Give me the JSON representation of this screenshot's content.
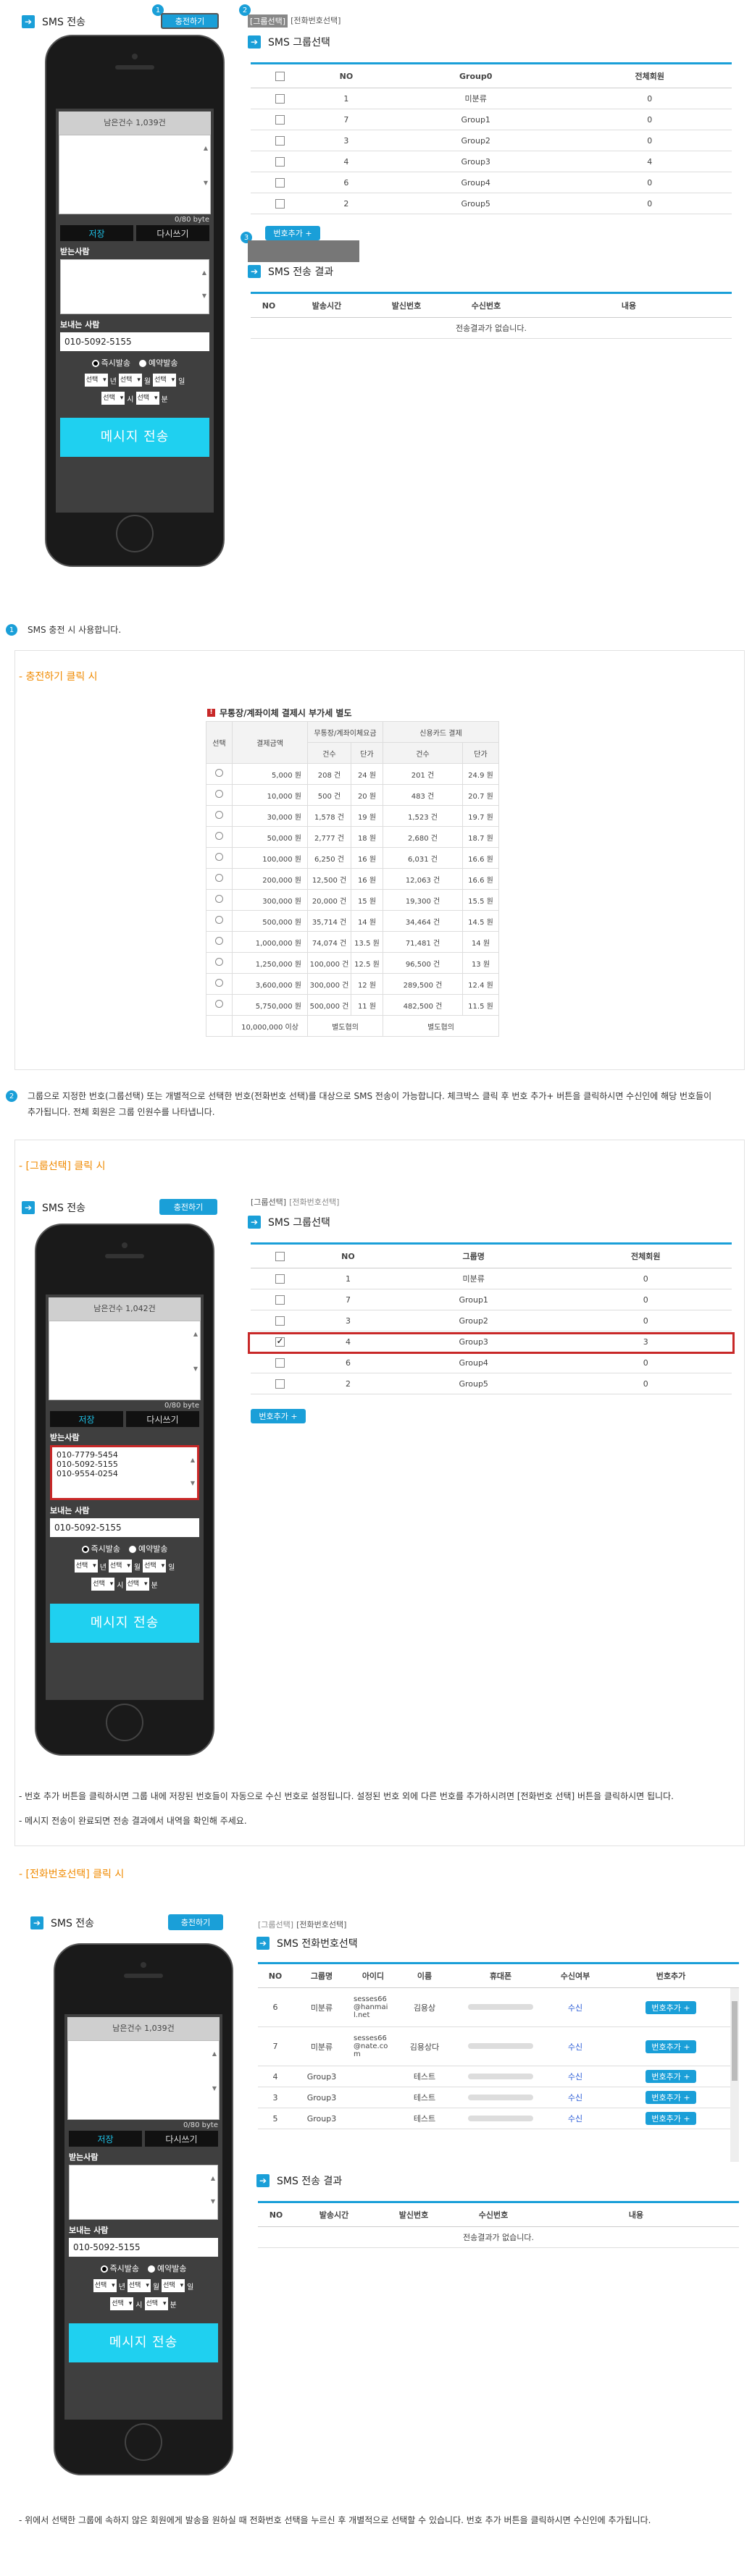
{
  "colors": {
    "accent": "#1a9fd8",
    "orange": "#f08a00",
    "red": "#c82828"
  },
  "top": {
    "sms_title": "SMS 전송",
    "charge_btn": "충전하기",
    "tab_group": "[그룹선택]",
    "tab_phone": "[전화번호선택]",
    "group_title": "SMS 그룹선택",
    "group_headers": [
      "",
      "NO",
      "Group0",
      "전체회원"
    ],
    "group_rows": [
      [
        "1",
        "미분류",
        "0"
      ],
      [
        "7",
        "Group1",
        "0"
      ],
      [
        "3",
        "Group2",
        "0"
      ],
      [
        "4",
        "Group3",
        "4"
      ],
      [
        "6",
        "Group4",
        "0"
      ],
      [
        "2",
        "Group5",
        "0"
      ]
    ],
    "add_btn": "번호추가 +",
    "result_title": "SMS 전송 결과",
    "result_headers": [
      "NO",
      "발송시간",
      "발신번호",
      "수신번호",
      "내용"
    ],
    "result_empty": "전송결과가 없습니다."
  },
  "phone": {
    "remain1": "남은건수 1,039건",
    "remain2": "남은건수 1,042건",
    "remain3": "남은건수 1,039건",
    "byte": "0/80 byte",
    "save": "저장",
    "rewrite": "다시쓰기",
    "recv_label": "받는사람",
    "send_label": "보내는 사람",
    "sender": "010-5092-5155",
    "radio_now": "즉시발송",
    "radio_reserve": "예약발송",
    "sel": "선택",
    "year": "년",
    "month": "월",
    "day": "일",
    "hour": "시",
    "minute": "분",
    "send_btn": "메시지 전송",
    "recv_numbers": [
      "010-7779-5454",
      "010-5092-5155",
      "010-9554-0254"
    ]
  },
  "badges": [
    "1",
    "2",
    "3"
  ],
  "note1": "SMS 충전 시 사용합니다.",
  "charge": {
    "heading": "- 충전하기 클릭 시",
    "table_title": "무통장/계좌이체 결제시 부가세 별도",
    "h_select": "선택",
    "h_amount": "결제금액",
    "h_bank": "무통장/계좌이체요금",
    "h_card": "신용카드 결제",
    "h_count": "건수",
    "h_unit": "단가",
    "rows": [
      [
        "5,000 원",
        "208 건",
        "24 원",
        "201 건",
        "24.9 원"
      ],
      [
        "10,000 원",
        "500 건",
        "20 원",
        "483 건",
        "20.7 원"
      ],
      [
        "30,000 원",
        "1,578 건",
        "19 원",
        "1,523 건",
        "19.7 원"
      ],
      [
        "50,000 원",
        "2,777 건",
        "18 원",
        "2,680 건",
        "18.7 원"
      ],
      [
        "100,000 원",
        "6,250 건",
        "16 원",
        "6,031 건",
        "16.6 원"
      ],
      [
        "200,000 원",
        "12,500 건",
        "16 원",
        "12,063 건",
        "16.6 원"
      ],
      [
        "300,000 원",
        "20,000 건",
        "15 원",
        "19,300 건",
        "15.5 원"
      ],
      [
        "500,000 원",
        "35,714 건",
        "14 원",
        "34,464 건",
        "14.5 원"
      ],
      [
        "1,000,000 원",
        "74,074 건",
        "13.5 원",
        "71,481 건",
        "14 원"
      ],
      [
        "1,250,000 원",
        "100,000 건",
        "12.5 원",
        "96,500 건",
        "13 원"
      ],
      [
        "3,600,000 원",
        "300,000 건",
        "12 원",
        "289,500 건",
        "12.4 원"
      ],
      [
        "5,750,000 원",
        "500,000 건",
        "11 원",
        "482,500 건",
        "11.5 원"
      ]
    ],
    "last_row": [
      "10,000,000 이상",
      "별도협의",
      "별도협의"
    ]
  },
  "note2_l1": "그룹으로 지정한 번호(그룹선택) 또는 개별적으로 선택한 번호(전화번호 선택)를 대상으로 SMS 전송이 가능합니다. 체크박스 클릭 후 번호 추가+ 버튼을 클릭하시면 수신인에 해당 번호들이",
  "note2_l2": "추가됩니다. 전체 회원은 그룹 인원수를 나타냅니다.",
  "group": {
    "heading": "- [그룹선택] 클릭 시",
    "headers": [
      "",
      "NO",
      "그룹명",
      "전체회원"
    ],
    "rows": [
      [
        "1",
        "미분류",
        "0"
      ],
      [
        "7",
        "Group1",
        "0"
      ],
      [
        "3",
        "Group2",
        "0"
      ],
      [
        "4",
        "Group3",
        "3"
      ],
      [
        "6",
        "Group4",
        "0"
      ],
      [
        "2",
        "Group5",
        "0"
      ]
    ],
    "checked_index": 3,
    "note1": "- 번호 추가 버튼을 클릭하시면 그룹 내에 저장된 번호들이 자동으로 수신 번호로 설정됩니다. 설정된 번호 외에 다른 번호를 추가하시려면 [전화번호 선택] 버튼을 클릭하시면 됩니다.",
    "note2": "- 메시지 전송이 완료되면 전송 결과에서 내역을 확인해 주세요."
  },
  "phonesel": {
    "heading": "- [전화번호선택] 클릭 시",
    "title": "SMS 전화번호선택",
    "headers": [
      "NO",
      "그룹명",
      "아이디",
      "이름",
      "휴대폰",
      "수신여부",
      "번호추가"
    ],
    "rows": [
      [
        "6",
        "미분류",
        "sesses66 @hanmai l.net",
        "김용상",
        "수신"
      ],
      [
        "7",
        "미분류",
        "sesses66 @nate.co m",
        "김용상다",
        "수신"
      ],
      [
        "4",
        "Group3",
        "",
        "테스트",
        "수신"
      ],
      [
        "3",
        "Group3",
        "",
        "테스트",
        "수신"
      ],
      [
        "5",
        "Group3",
        "",
        "테스트",
        "수신"
      ]
    ],
    "note": "- 위에서 선택한 그룹에 속하지 않은 회원에게 발송을 원하실 때 전화번호 선택을 누르신 후 개별적으로 선택할 수 있습니다. 번호 추가 버튼을 클릭하시면 수신인에 추가됩니다."
  }
}
